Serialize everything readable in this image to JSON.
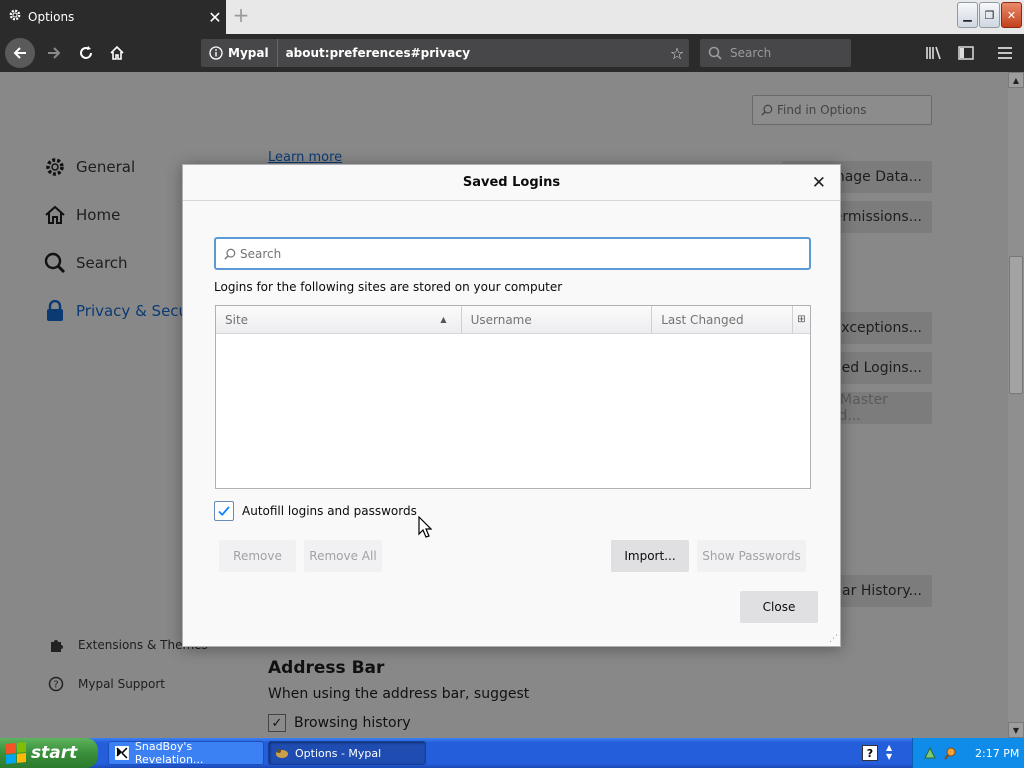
{
  "browser": {
    "tab_title": "Options",
    "tab_close": "✕",
    "new_tab": "+",
    "identity_label": "Mypal",
    "url": "about:preferences#privacy",
    "search_placeholder": "Search",
    "window_buttons": {
      "minimize": "▁",
      "restore": "❐",
      "close": "✕"
    }
  },
  "preferences": {
    "find_placeholder": "Find in Options",
    "categories": [
      "General",
      "Home",
      "Search",
      "Privacy & Security"
    ],
    "footer_links": [
      "Extensions & Themes",
      "Mypal Support"
    ],
    "learn_more": "Learn more",
    "bg_buttons": [
      "Manage Data...",
      "Permissions...",
      "Exceptions...",
      "Saved Logins...",
      "Change Master Password...",
      "Clear History..."
    ],
    "address_bar_heading": "Address Bar",
    "address_bar_sub": "When using the address bar, suggest",
    "browsing_history_label": "Browsing history"
  },
  "dialog": {
    "title": "Saved Logins",
    "close_glyph": "✕",
    "search_placeholder": "Search",
    "description": "Logins for the following sites are stored on your computer",
    "columns": [
      "Site",
      "Username",
      "Last Changed"
    ],
    "sort_indicator": "▲",
    "column_picker": "⊞",
    "autofill_label": "Autofill logins and passwords",
    "autofill_checked": true,
    "buttons": {
      "remove": "Remove",
      "remove_all": "Remove All",
      "import": "Import...",
      "show_passwords": "Show Passwords",
      "close": "Close"
    }
  },
  "taskbar": {
    "start_label": "start",
    "tasks": [
      "SnadBoy's Revelation...",
      "Options - Mypal"
    ],
    "clock": "2:17 PM"
  },
  "colors": {
    "accent": "#0a84ff",
    "focus_ring": "#5b9bd5",
    "toolbar_dark": "#2b2b2b",
    "dim_overlay": "#888888",
    "taskbar_blue": "#245edb",
    "start_green": "#3a8f3a"
  }
}
